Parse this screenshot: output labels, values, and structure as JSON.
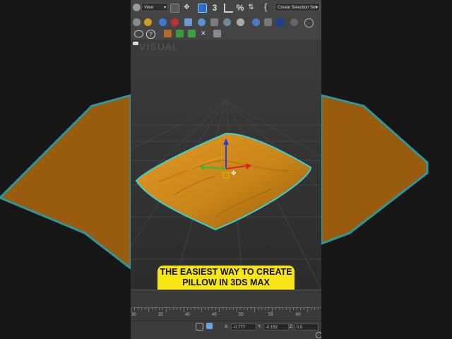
{
  "toolbar": {
    "view_dropdown": "View",
    "selection_set": "Create Selection Set",
    "snap_3": "3",
    "percent_snap": "%",
    "brace": "{"
  },
  "watermark": "VISUAL",
  "caption": "THE EASIEST WAY TO CREATE PILLOW IN 3DS MAX",
  "timeline": {
    "ticks": [
      "30",
      "35",
      "40",
      "45",
      "50",
      "55",
      "60"
    ]
  },
  "status": {
    "x_label": "X:",
    "x_value": "-0.777",
    "y_label": "Y:",
    "y_value": "-0.152",
    "z_label": "Z:",
    "z_value": "0.0"
  },
  "colors": {
    "pillow": "#d08a1c",
    "outline": "#39d0d8",
    "caption_bg": "#f7e515"
  }
}
